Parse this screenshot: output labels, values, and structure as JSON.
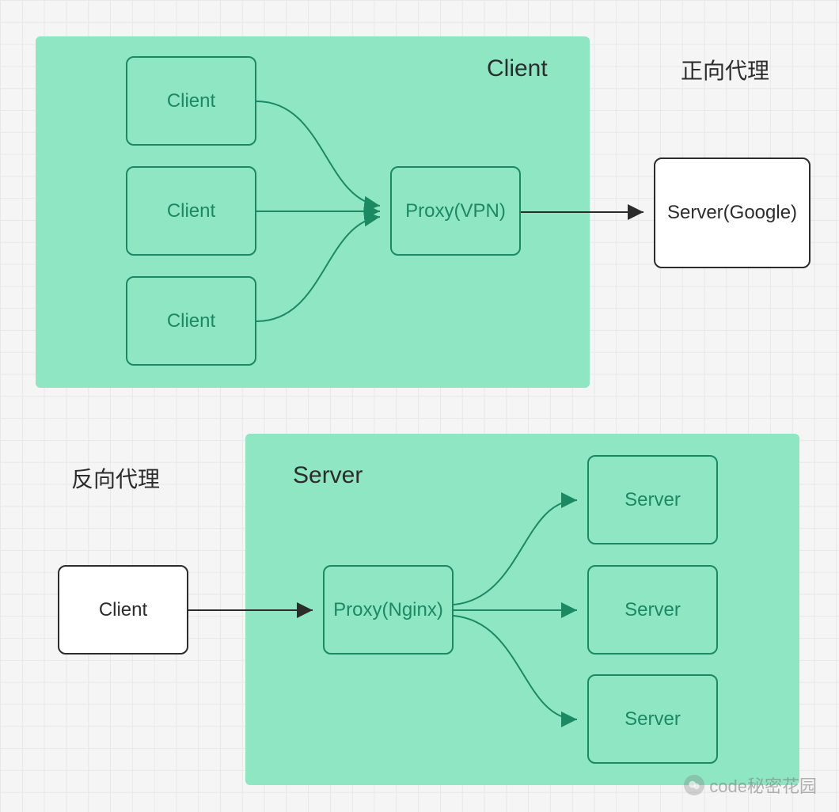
{
  "forward": {
    "title": "正向代理",
    "container_label": "Client",
    "clients": [
      "Client",
      "Client",
      "Client"
    ],
    "proxy_label": "Proxy(VPN)",
    "server_label": "Server(Google)"
  },
  "reverse": {
    "title": "反向代理",
    "container_label": "Server",
    "client_label": "Client",
    "proxy_label": "Proxy(Nginx)",
    "servers": [
      "Server",
      "Server",
      "Server"
    ]
  },
  "watermark": {
    "text": "code秘密花园"
  },
  "colors": {
    "container_bg": "#8ee6c2",
    "box_green": "#1b8a63",
    "box_black": "#2c2c2c"
  }
}
